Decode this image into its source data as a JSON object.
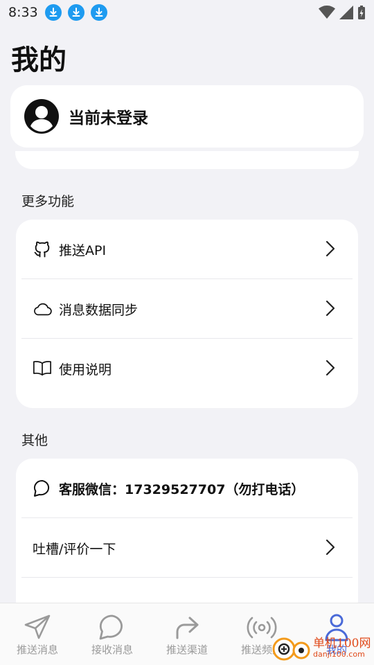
{
  "status_bar": {
    "time": "8:33",
    "download_icons": [
      "download-icon",
      "download-icon",
      "download-icon"
    ],
    "right_icons": [
      "wifi-icon",
      "signal-icon",
      "battery-charging-icon"
    ],
    "accent": "#1e9bf0"
  },
  "page": {
    "title": "我的"
  },
  "account": {
    "status": "当前未登录",
    "icon": "avatar-icon"
  },
  "more_features": {
    "label": "更多功能",
    "items": [
      {
        "icon": "github-icon",
        "label": "推送API"
      },
      {
        "icon": "cloud-icon",
        "label": "消息数据同步"
      },
      {
        "icon": "book-icon",
        "label": "使用说明"
      }
    ]
  },
  "others": {
    "label": "其他",
    "items": [
      {
        "icon": "chat-bubble-icon",
        "label": "客服微信：17329527707（勿打电话）"
      },
      {
        "icon": "",
        "label": "吐槽/评价一下"
      }
    ]
  },
  "tab_bar": {
    "items": [
      {
        "icon": "send-icon",
        "label": "推送消息"
      },
      {
        "icon": "chat-bubble-icon",
        "label": "接收消息"
      },
      {
        "icon": "forward-arrow-icon",
        "label": "推送渠道"
      },
      {
        "icon": "broadcast-icon",
        "label": "推送频道"
      },
      {
        "icon": "person-icon",
        "label": "我的"
      }
    ],
    "active_index": 4,
    "active_color": "#4a6ad8",
    "inactive_color": "#9a9a9a"
  },
  "watermark": {
    "brand": "单机100网",
    "domain": "danji100.com"
  }
}
